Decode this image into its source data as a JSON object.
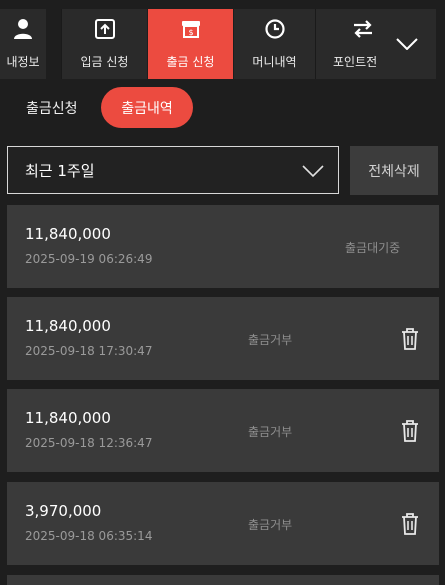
{
  "nav": {
    "tabs": [
      {
        "label": "내정보",
        "icon": "user-icon",
        "active": false
      },
      {
        "label": "입금 신청",
        "icon": "deposit-icon",
        "active": false
      },
      {
        "label": "출금 신청",
        "icon": "withdraw-icon",
        "active": true
      },
      {
        "label": "머니내역",
        "icon": "clock-icon",
        "active": false
      },
      {
        "label": "포인트전",
        "icon": "transfer-icon",
        "active": false
      }
    ],
    "more_icon": "chevron-down-icon"
  },
  "subtabs": {
    "request_label": "출금신청",
    "history_label": "출금내역"
  },
  "filter": {
    "selected": "최근 1주일",
    "delete_all_label": "전체삭제"
  },
  "records": [
    {
      "amount": "11,840,000",
      "date": "2025-09-19 06:26:49",
      "status": "출금대기중",
      "deletable": false
    },
    {
      "amount": "11,840,000",
      "date": "2025-09-18 17:30:47",
      "status": "출금거부",
      "deletable": true
    },
    {
      "amount": "11,840,000",
      "date": "2025-09-18 12:36:47",
      "status": "출금거부",
      "deletable": true
    },
    {
      "amount": "3,970,000",
      "date": "2025-09-18 06:35:14",
      "status": "출금거부",
      "deletable": true
    }
  ],
  "colors": {
    "accent": "#ec4b40",
    "background": "#1e1e1e",
    "card": "#3a3a3a"
  }
}
